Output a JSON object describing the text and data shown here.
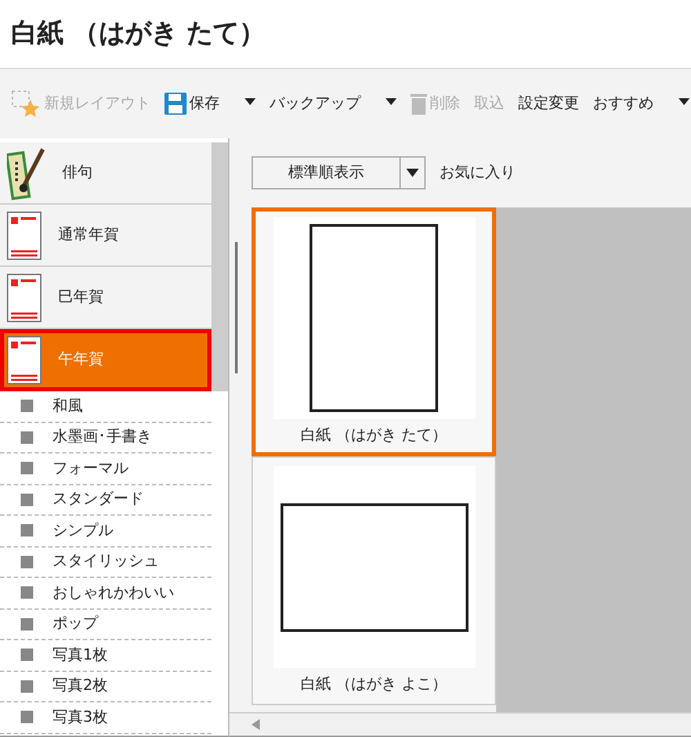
{
  "window": {
    "title": "白紙 （はがき たて）"
  },
  "toolbar": [
    {
      "label": "新規レイアウト",
      "disabled": true,
      "dropdown": false
    },
    {
      "label": "保存",
      "disabled": false,
      "dropdown": true
    },
    {
      "label": "バックアップ",
      "disabled": false,
      "dropdown": true
    },
    {
      "label": "削除",
      "disabled": true,
      "dropdown": false
    },
    {
      "label": "取込",
      "disabled": true,
      "dropdown": false
    },
    {
      "label": "設定変更",
      "disabled": false,
      "dropdown": false
    },
    {
      "label": "おすすめ",
      "disabled": false,
      "dropdown": true
    }
  ],
  "categories": [
    {
      "label": "俳句",
      "kind": "haiku",
      "selected": false
    },
    {
      "label": "通常年賀",
      "kind": "card",
      "selected": false
    },
    {
      "label": "巳年賀",
      "kind": "card",
      "selected": false
    },
    {
      "label": "午年賀",
      "kind": "card",
      "selected": true
    }
  ],
  "subcategories": [
    "和風",
    "水墨画･手書き",
    "フォーマル",
    "スタンダード",
    "シンプル",
    "スタイリッシュ",
    "おしゃれかわいい",
    "ポップ",
    "写真1枚",
    "写真2枚",
    "写真3枚"
  ],
  "sort": {
    "value": "標準順表示"
  },
  "favorites": "お気に入り",
  "templates": [
    {
      "caption": "白紙 （はがき たて）",
      "kind": "portrait",
      "selected": true
    },
    {
      "caption": "白紙 （はがき よこ）",
      "kind": "landscape",
      "selected": false
    }
  ]
}
